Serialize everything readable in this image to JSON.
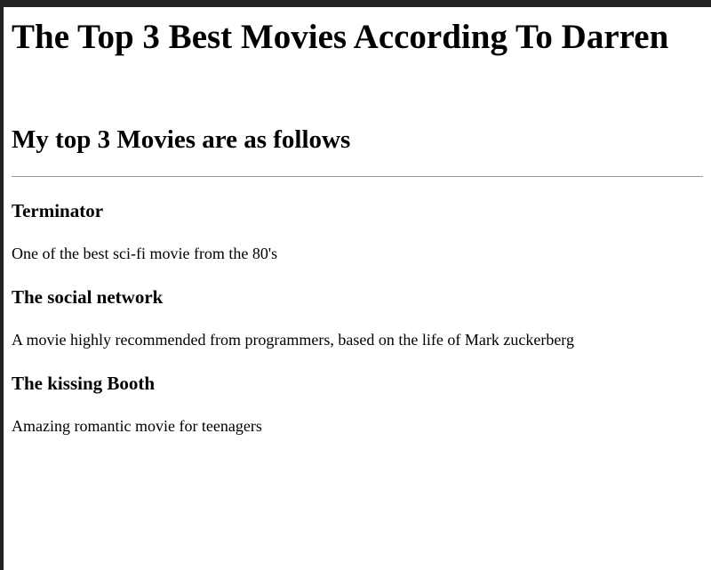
{
  "page": {
    "heading": "The Top 3 Best Movies According To Darren",
    "subheading": "My top 3 Movies are as follows"
  },
  "movies": [
    {
      "title": "Terminator",
      "description": "One of the best sci-fi movie from the 80's"
    },
    {
      "title": "The social network",
      "description": "A movie highly recommended from programmers, based on the life of Mark zuckerberg"
    },
    {
      "title": "The kissing Booth",
      "description": "Amazing romantic movie for teenagers"
    }
  ],
  "colors": {
    "background": "#ffffff",
    "text": "#000000",
    "divider": "#9a9a9a",
    "frame": "#222222"
  }
}
